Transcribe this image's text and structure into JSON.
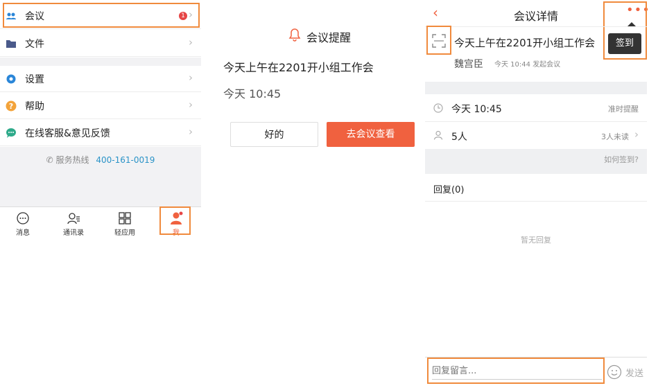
{
  "menu": {
    "meeting": {
      "label": "会议",
      "badge": "1"
    },
    "files": {
      "label": "文件"
    },
    "settings": {
      "label": "设置"
    },
    "help": {
      "label": "帮助"
    },
    "support": {
      "label": "在线客服&意见反馈"
    },
    "hotline_label": "服务热线",
    "hotline_number": "400-161-0019"
  },
  "tabbar": [
    {
      "label": "消息",
      "icon": "message-icon"
    },
    {
      "label": "通讯录",
      "icon": "contacts-icon"
    },
    {
      "label": "轻应用",
      "icon": "apps-icon"
    },
    {
      "label": "我",
      "icon": "profile-icon"
    }
  ],
  "reminder": {
    "title": "会议提醒",
    "message": "今天上午在2201开小组工作会",
    "time": "今天 10:45",
    "ok_button": "好的",
    "view_button": "去会议查看"
  },
  "detail": {
    "header_title": "会议详情",
    "checkin_popup": "签到",
    "meeting_title": "今天上午在2201开小组工作会",
    "organizer": "魏宫臣",
    "created_info": "今天 10:44 发起会议",
    "time": "今天 10:45",
    "reminder_type": "准时提醒",
    "people": "5人",
    "unread": "3人未读",
    "how_checkin": "如何签到?",
    "replies": "回复(0)",
    "no_replies": "暂无回复",
    "reply_placeholder": "回复留言...",
    "send": "发送"
  },
  "colors": {
    "accent": "#f0613f",
    "highlight": "#f08a3c",
    "link": "#2a93c7"
  }
}
